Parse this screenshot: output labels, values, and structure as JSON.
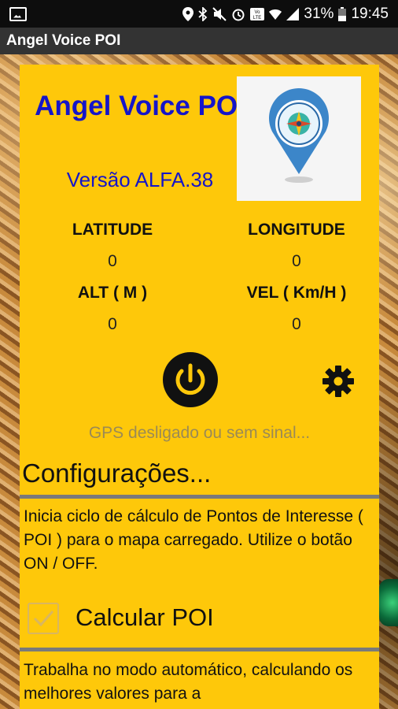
{
  "status_bar": {
    "left_icon": "gallery-icon",
    "icons": [
      "location-icon",
      "bluetooth-icon",
      "mute-icon",
      "alarm-icon",
      "volte-icon",
      "wifi-icon",
      "signal-icon"
    ],
    "battery": "31%",
    "time": "19:45"
  },
  "app_bar": {
    "title": "Angel Voice POI"
  },
  "header": {
    "app_name": "Angel Voice POI",
    "version": "Versão ALFA.38",
    "logo_icon": "map-pin-compass-icon"
  },
  "coords": {
    "latitude_label": "LATITUDE",
    "latitude_value": "0",
    "longitude_label": "LONGITUDE",
    "longitude_value": "0",
    "alt_label": "ALT ( M )",
    "alt_value": "0",
    "vel_label": "VEL ( Km/H )",
    "vel_value": "0"
  },
  "controls": {
    "power_icon": "power-icon",
    "settings_icon": "gear-icon"
  },
  "gps_status": "GPS desligado ou sem sinal...",
  "config": {
    "title": "Configurações...",
    "desc1": "Inicia ciclo de cálculo de Pontos de Interesse ( POI ) para o mapa carregado. Utilize o botão ON / OFF.",
    "checkbox_label": "Calcular POI",
    "checkbox_checked": true,
    "desc2": "Trabalha no modo automático, calculando os melhores valores para a"
  },
  "colors": {
    "panel": "#fec80a",
    "title_blue": "#1515c9",
    "gps_text": "#9b8a55"
  }
}
